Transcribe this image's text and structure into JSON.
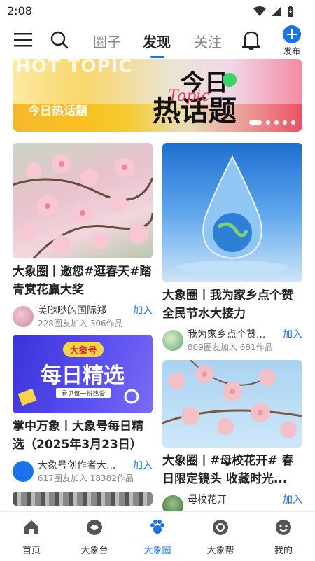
{
  "status": {
    "time": "2:08"
  },
  "nav": {
    "tabs": [
      {
        "label": "圈子"
      },
      {
        "label": "发现"
      },
      {
        "label": "关注"
      }
    ],
    "publish_label": "发布"
  },
  "banner": {
    "bg_text": "HOT TOPIC",
    "caption": "今日热话题",
    "big_top": "今日",
    "big_bottom": "热话题",
    "script": "Topic"
  },
  "cards": [
    {
      "title": "大象圈丨邀您#逛春天#踏青赏花赢大奖",
      "name": "美哒哒的国际郑",
      "stats": "228圈友加入 306作品",
      "join": "加入"
    },
    {
      "title": "大象圈丨我为家乡点个赞 全民节水大接力",
      "name": "我为家乡点个赞...",
      "stats": "809圈友加入 681作品",
      "join": "加入"
    },
    {
      "title": "掌中万象丨大象号每日精选（2025年3月23日）",
      "name": "大象号创作者大...",
      "stats": "617圈友加入 18382作品",
      "join": "加入",
      "img_badge": "大象号",
      "img_text": "每日精选",
      "img_sub": "看见每一份热爱"
    },
    {
      "title": "大象圈丨#母校花开# 春日限定镜头 收藏时光...",
      "name": "母校花开",
      "join": "加入"
    }
  ],
  "bottom": {
    "items": [
      {
        "label": "首页"
      },
      {
        "label": "大象台"
      },
      {
        "label": "大象圈"
      },
      {
        "label": "大象帮"
      },
      {
        "label": "我的"
      }
    ]
  },
  "colors": {
    "accent": "#1a73e8"
  }
}
